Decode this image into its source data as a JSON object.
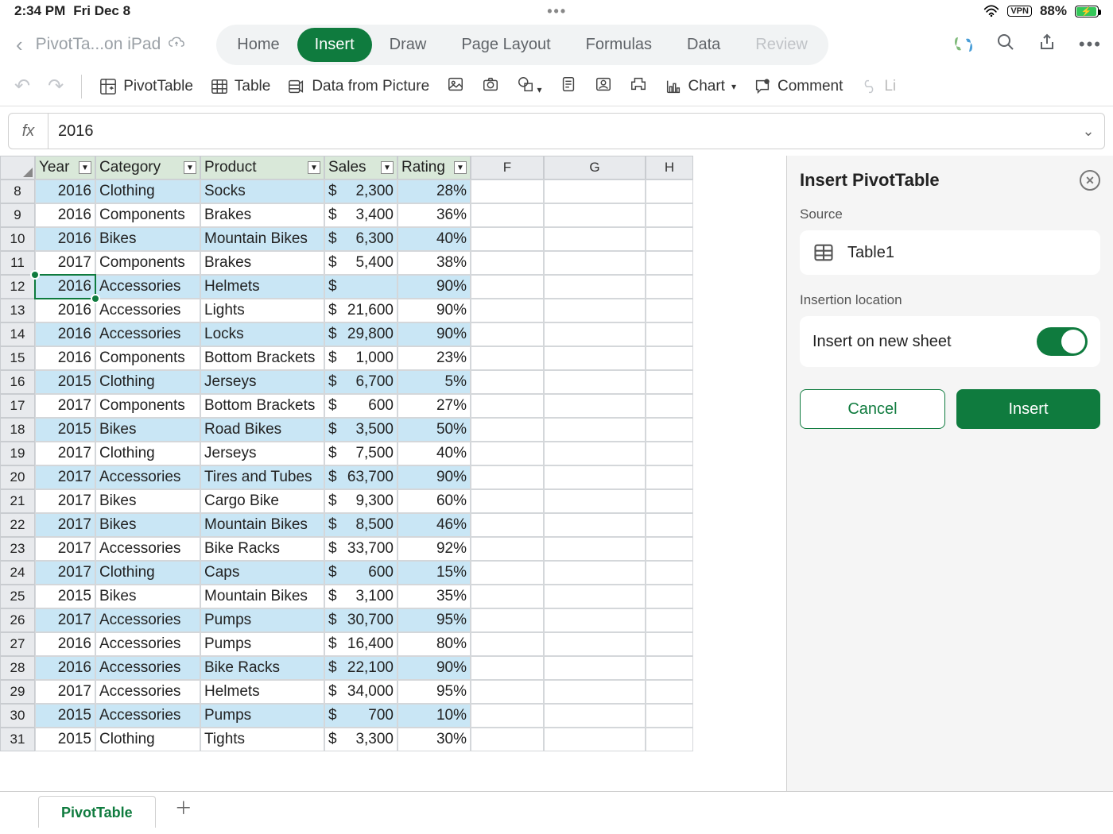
{
  "status": {
    "time": "2:34 PM",
    "date": "Fri Dec 8",
    "vpn": "VPN",
    "battery_pct": "88%",
    "battery_fill_width": "88%"
  },
  "doc": {
    "title": "PivotTa...on iPad"
  },
  "tabs": {
    "home": "Home",
    "insert": "Insert",
    "draw": "Draw",
    "pagelayout": "Page Layout",
    "formulas": "Formulas",
    "data": "Data",
    "review": "Review"
  },
  "ribbon": {
    "pivottable": "PivotTable",
    "table": "Table",
    "datafrompic": "Data from Picture",
    "chart": "Chart",
    "comment": "Comment",
    "link": "Li"
  },
  "fx": {
    "label": "fx",
    "value": "2016"
  },
  "colheaders": {
    "year": "Year",
    "category": "Category",
    "product": "Product",
    "sales": "Sales",
    "rating": "Rating",
    "f": "F",
    "g": "G",
    "h": "H"
  },
  "active_row": "12",
  "rows": [
    {
      "n": "8",
      "year": "2016",
      "cat": "Clothing",
      "prod": "Socks",
      "sales": "2,300",
      "rating": "28%"
    },
    {
      "n": "9",
      "year": "2016",
      "cat": "Components",
      "prod": "Brakes",
      "sales": "3,400",
      "rating": "36%"
    },
    {
      "n": "10",
      "year": "2016",
      "cat": "Bikes",
      "prod": "Mountain Bikes",
      "sales": "6,300",
      "rating": "40%"
    },
    {
      "n": "11",
      "year": "2017",
      "cat": "Components",
      "prod": "Brakes",
      "sales": "5,400",
      "rating": "38%"
    },
    {
      "n": "12",
      "year": "2016",
      "cat": "Accessories",
      "prod": "Helmets",
      "sales": "",
      "rating": "90%"
    },
    {
      "n": "13",
      "year": "2016",
      "cat": "Accessories",
      "prod": "Lights",
      "sales": "21,600",
      "rating": "90%"
    },
    {
      "n": "14",
      "year": "2016",
      "cat": "Accessories",
      "prod": "Locks",
      "sales": "29,800",
      "rating": "90%"
    },
    {
      "n": "15",
      "year": "2016",
      "cat": "Components",
      "prod": "Bottom Brackets",
      "sales": "1,000",
      "rating": "23%"
    },
    {
      "n": "16",
      "year": "2015",
      "cat": "Clothing",
      "prod": "Jerseys",
      "sales": "6,700",
      "rating": "5%"
    },
    {
      "n": "17",
      "year": "2017",
      "cat": "Components",
      "prod": "Bottom Brackets",
      "sales": "600",
      "rating": "27%"
    },
    {
      "n": "18",
      "year": "2015",
      "cat": "Bikes",
      "prod": "Road Bikes",
      "sales": "3,500",
      "rating": "50%"
    },
    {
      "n": "19",
      "year": "2017",
      "cat": "Clothing",
      "prod": "Jerseys",
      "sales": "7,500",
      "rating": "40%"
    },
    {
      "n": "20",
      "year": "2017",
      "cat": "Accessories",
      "prod": "Tires and Tubes",
      "sales": "63,700",
      "rating": "90%"
    },
    {
      "n": "21",
      "year": "2017",
      "cat": "Bikes",
      "prod": "Cargo Bike",
      "sales": "9,300",
      "rating": "60%"
    },
    {
      "n": "22",
      "year": "2017",
      "cat": "Bikes",
      "prod": "Mountain Bikes",
      "sales": "8,500",
      "rating": "46%"
    },
    {
      "n": "23",
      "year": "2017",
      "cat": "Accessories",
      "prod": "Bike Racks",
      "sales": "33,700",
      "rating": "92%"
    },
    {
      "n": "24",
      "year": "2017",
      "cat": "Clothing",
      "prod": "Caps",
      "sales": "600",
      "rating": "15%"
    },
    {
      "n": "25",
      "year": "2015",
      "cat": "Bikes",
      "prod": "Mountain Bikes",
      "sales": "3,100",
      "rating": "35%"
    },
    {
      "n": "26",
      "year": "2017",
      "cat": "Accessories",
      "prod": "Pumps",
      "sales": "30,700",
      "rating": "95%"
    },
    {
      "n": "27",
      "year": "2016",
      "cat": "Accessories",
      "prod": "Pumps",
      "sales": "16,400",
      "rating": "80%"
    },
    {
      "n": "28",
      "year": "2016",
      "cat": "Accessories",
      "prod": "Bike Racks",
      "sales": "22,100",
      "rating": "90%"
    },
    {
      "n": "29",
      "year": "2017",
      "cat": "Accessories",
      "prod": "Helmets",
      "sales": "34,000",
      "rating": "95%"
    },
    {
      "n": "30",
      "year": "2015",
      "cat": "Accessories",
      "prod": "Pumps",
      "sales": "700",
      "rating": "10%"
    },
    {
      "n": "31",
      "year": "2015",
      "cat": "Clothing",
      "prod": "Tights",
      "sales": "3,300",
      "rating": "30%"
    }
  ],
  "panel": {
    "title": "Insert PivotTable",
    "source_label": "Source",
    "source_value": "Table1",
    "loc_label": "Insertion location",
    "newsheet": "Insert on new sheet",
    "cancel": "Cancel",
    "insert": "Insert"
  },
  "sheettab": "PivotTable"
}
